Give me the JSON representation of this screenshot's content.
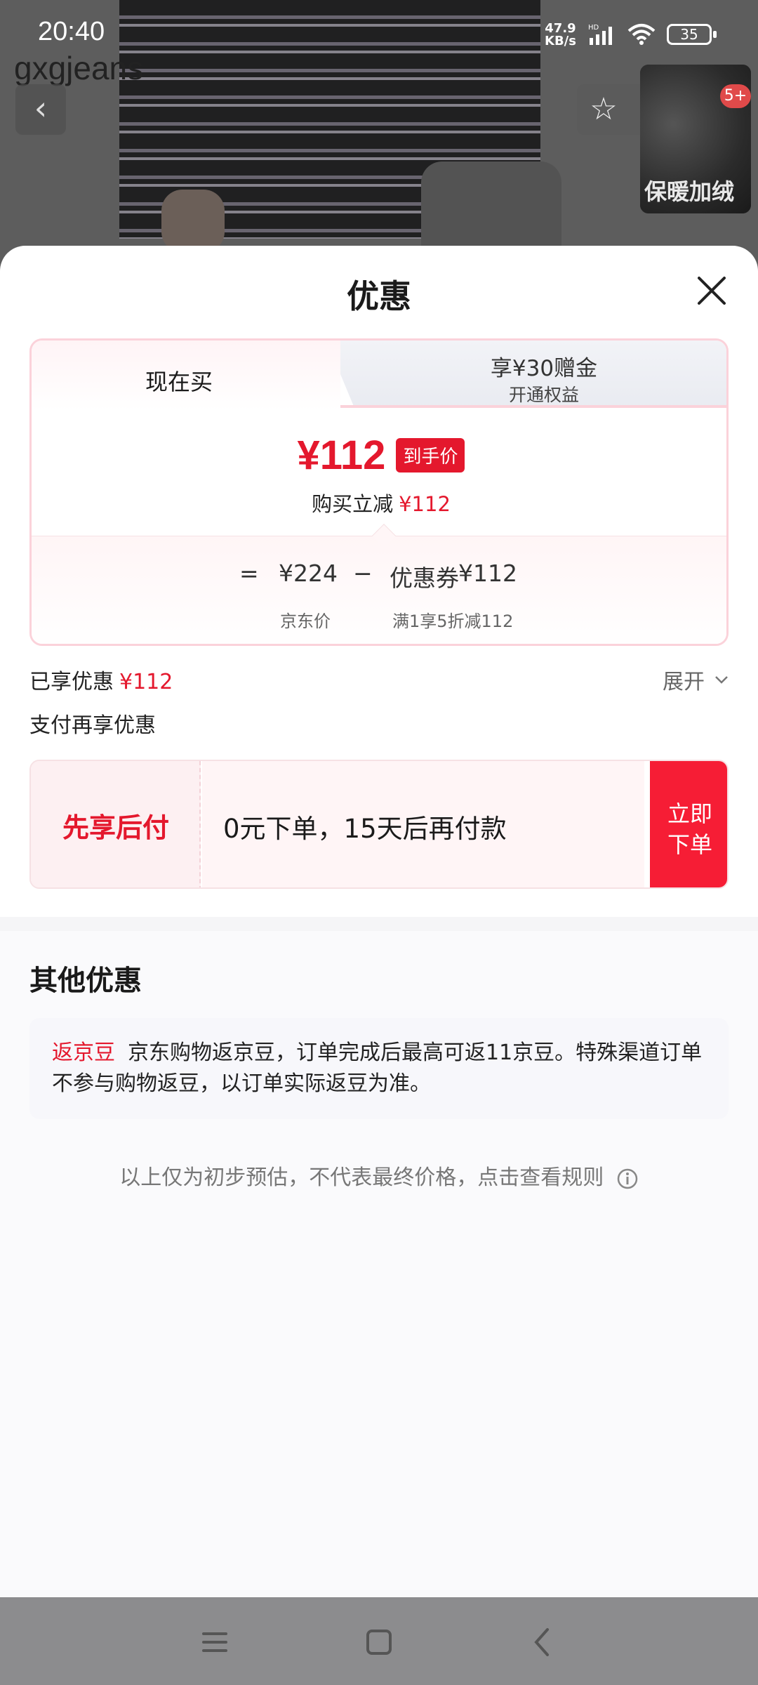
{
  "status_bar": {
    "time": "20:40",
    "net_speed_value": "47.9",
    "net_speed_unit": "KB/s",
    "hd": "HD",
    "battery": "35"
  },
  "background": {
    "watermark": "gxgjeans",
    "thumbnail_label": "保暖加绒",
    "cart_badge": "5+"
  },
  "sheet": {
    "title": "优惠",
    "tabs": [
      {
        "label": "现在买",
        "active": true
      },
      {
        "label": "享¥30赠金",
        "sublabel": "开通权益",
        "active": false
      }
    ],
    "price": {
      "final": "¥112",
      "final_tag": "到手价",
      "discount_text": "购买立减",
      "discount_value": "¥112"
    },
    "calc": {
      "equals": "=",
      "jd_price": "¥224",
      "minus": "−",
      "coupon_label": "优惠券",
      "coupon_value": "¥112",
      "jd_price_caption": "京东价",
      "coupon_caption": "满1享5折减112"
    },
    "enjoyed": {
      "label": "已享优惠",
      "value": "¥112",
      "expand": "展开"
    },
    "pay": {
      "title": "支付再享优惠",
      "left_label": "先享后付",
      "description": "0元下单，15天后再付款",
      "button_line1": "立即",
      "button_line2": "下单"
    },
    "other": {
      "title": "其他优惠",
      "tag": "返京豆",
      "text": "京东购物返京豆，订单完成后最高可返11京豆。特殊渠道订单不参与购物返豆，以订单实际返豆为准。"
    },
    "note": "以上仅为初步预估，不代表最终价格，点击查看规则"
  },
  "colors": {
    "accent_red": "#e4182d",
    "button_red": "#f61d35",
    "card_border": "#fbd2da"
  },
  "icons": [
    "back-icon",
    "star-icon",
    "share-icon",
    "more-icon",
    "close-icon",
    "chevron-down-icon",
    "info-icon",
    "menu-icon",
    "home-icon",
    "nav-back-icon"
  ]
}
